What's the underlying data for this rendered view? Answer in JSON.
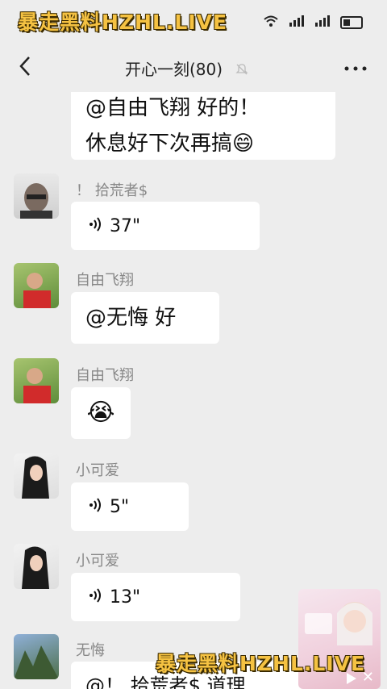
{
  "watermark": "暴走黑料HZHL.LIVE",
  "header": {
    "title": "开心一刻(80)",
    "back_icon": "‹",
    "more_icon": "···"
  },
  "messages": [
    {
      "type": "text",
      "text_line1": "@自由飞翔  好的！",
      "text_line2": "休息好下次再搞😄"
    },
    {
      "sender": "！ 拾荒者$",
      "type": "voice",
      "duration": "37\""
    },
    {
      "sender": "自由飞翔",
      "type": "text",
      "text": "@无悔  好"
    },
    {
      "sender": "自由飞翔",
      "type": "emoji",
      "emoji": "😭"
    },
    {
      "sender": "小可爱",
      "type": "voice",
      "duration": "5\""
    },
    {
      "sender": "小可爱",
      "type": "voice",
      "duration": "13\""
    },
    {
      "sender": "无悔",
      "type": "text",
      "text": "@！ 拾荒者$ 道理"
    }
  ],
  "colors": {
    "background": "#ededed",
    "bubble": "#ffffff",
    "watermark": "#f5c242"
  }
}
